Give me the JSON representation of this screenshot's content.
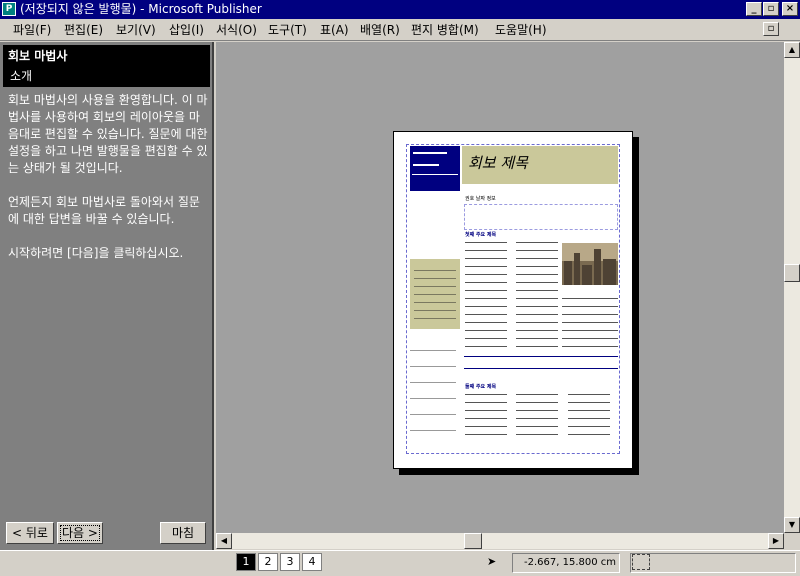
{
  "app": {
    "title": "(저장되지 않은 발행물) - Microsoft Publisher",
    "icon_label": "P"
  },
  "window_controls": {
    "minimize": "_",
    "restore": "▫",
    "close": "×"
  },
  "menu": {
    "items": [
      "파일(F)",
      "편집(E)",
      "보기(V)",
      "삽입(I)",
      "서식(O)",
      "도구(T)",
      "표(A)",
      "배열(R)",
      "편지 병합(M)",
      "도움말(H)"
    ]
  },
  "wizard": {
    "title": "회보 마법사",
    "subtitle": "소개",
    "paragraphs": [
      "회보 마법사의 사용을 환영합니다. 이 마법사를 사용하여 회보의 레이아웃을 마음대로 편집할 수 있습니다. 질문에 대한 설정을 하고 나면 발행물을 편집할 수 있는 상태가 될 것입니다.",
      "언제든지 회보 마법사로 돌아와서 질문에 대한 답변을 바꿀 수 있습니다.",
      "시작하려면 [다음]을 클릭하십시오."
    ],
    "back_label": "< 뒤로",
    "next_label": "다음 >",
    "finish_label": "마침"
  },
  "newsletter": {
    "title": "회보 제목",
    "volume": "권호 날짜 정보",
    "story1": "첫째 주요 제목",
    "story2": "둘째 주요 제목"
  },
  "status": {
    "pages": [
      "1",
      "2",
      "3",
      "4"
    ],
    "active_page": "1",
    "coordinates": "-2.667, 15.800 cm"
  }
}
